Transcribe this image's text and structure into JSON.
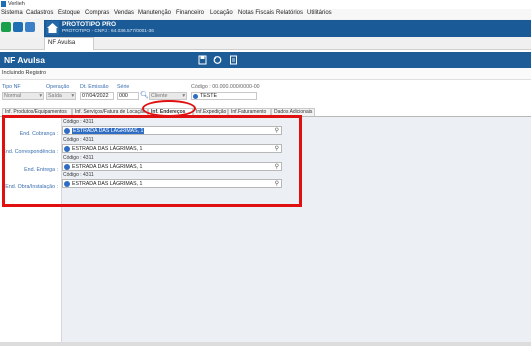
{
  "window": {
    "title": "Verlieh"
  },
  "menu": [
    "Sistema",
    "Cadastros",
    "Estoque",
    "Compras",
    "Vendas",
    "Manutenção",
    "Financeiro",
    "Locação",
    "Notas Fiscais",
    "Relatórios",
    "Utilitários"
  ],
  "brand": {
    "title": "PROTOTIPO PRO",
    "subtitle": "PROTOTIPO - CNPJ : 64.036.577/0001-36"
  },
  "tabs": {
    "nf": "NF Avulsa"
  },
  "header": {
    "title": "NF Avulsa"
  },
  "status": {
    "mode": "Incluindo Registro"
  },
  "form": {
    "tipo_nf": {
      "label": "Tipo NF",
      "value": "Normal"
    },
    "operacao": {
      "label": "Operação",
      "value": "Saída"
    },
    "dt_emissao": {
      "label": "Dt. Emissão",
      "value": "07/04/2022"
    },
    "serie": {
      "label": "Série",
      "value": "000"
    },
    "cliente": {
      "placeholder": "Cliente"
    },
    "codigo": {
      "label": "Código : 00.000.000/0000-00",
      "value": "TESTE"
    }
  },
  "subtabs": [
    "Inf. Produtos/Equipamentos",
    "Inf. Serviços/Fatura de Locação",
    "Inf. Endereços",
    "Inf.Expedição",
    "Inf.Faturamento",
    "Dados Adicionais"
  ],
  "addresses": [
    {
      "label": "End. Cobrança :",
      "code": "Código : 4311",
      "value": "ESTRADA DAS LÁGRIMAS, 1"
    },
    {
      "label": "End. Correspondência :",
      "code": "Código : 4311",
      "value": "ESTRADA DAS LÁGRIMAS, 1"
    },
    {
      "label": "End. Entrega :",
      "code": "Código : 4311",
      "value": "ESTRADA DAS LÁGRIMAS, 1"
    },
    {
      "label": "End. Obra/Instalação :",
      "code": "Código : 4311",
      "value": "ESTRADA DAS LÁGRIMAS, 1"
    }
  ],
  "colors": {
    "brand": "#1a5a97",
    "highlight": "#e01010",
    "label": "#3a6fb0"
  }
}
